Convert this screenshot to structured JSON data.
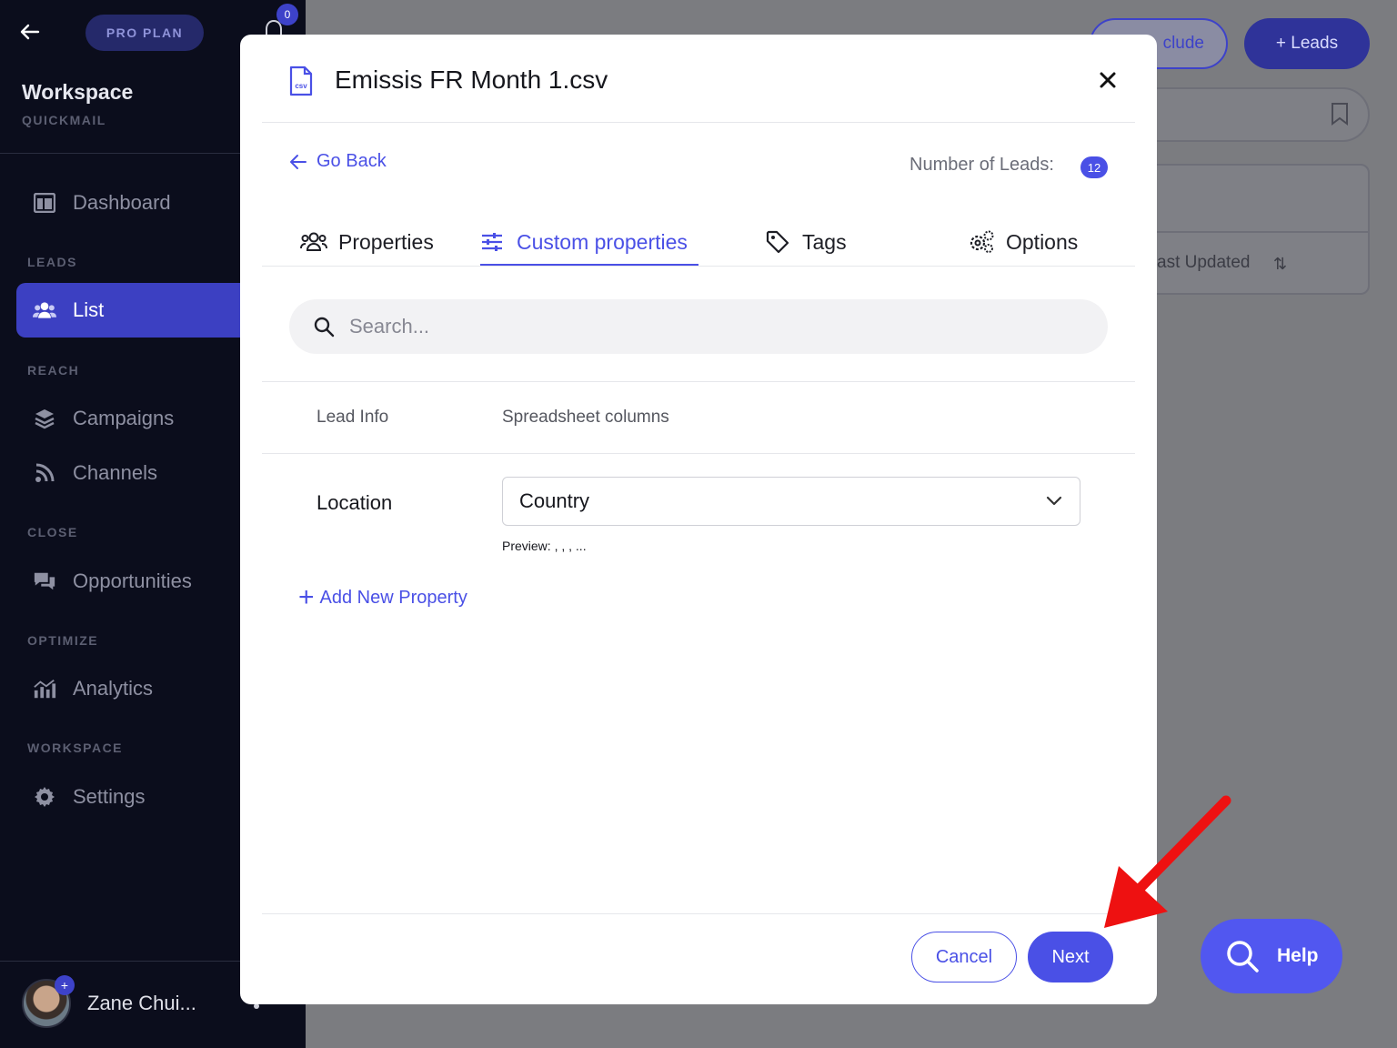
{
  "sidebar": {
    "plan": "PRO PLAN",
    "notifications": "0",
    "workspace_title": "Workspace",
    "workspace_sub": "QUICKMAIL",
    "items": [
      {
        "section": "",
        "label": "Dashboard",
        "icon": "dashboard-icon",
        "active": false
      },
      {
        "section": "LEADS",
        "label": "List",
        "icon": "users-icon",
        "active": true
      },
      {
        "section": "REACH",
        "label": "Campaigns",
        "icon": "layers-icon",
        "active": false
      },
      {
        "section": "",
        "label": "Channels",
        "icon": "rss-icon",
        "active": false
      },
      {
        "section": "CLOSE",
        "label": "Opportunities",
        "icon": "chat-icon",
        "active": false
      },
      {
        "section": "OPTIMIZE",
        "label": "Analytics",
        "icon": "analytics-icon",
        "active": false
      },
      {
        "section": "WORKSPACE",
        "label": "Settings",
        "icon": "gear-icon",
        "active": false
      }
    ],
    "sections": {
      "leads": "LEADS",
      "reach": "REACH",
      "close": "CLOSE",
      "optimize": "OPTIMIZE",
      "workspace": "WORKSPACE"
    },
    "user_name": "Zane Chui...",
    "avatar_plus": "+"
  },
  "background": {
    "exclude_label": "clude",
    "leads_button": "+ Leads",
    "last_updated": "ast Updated",
    "sort_glyph": "⇅"
  },
  "modal": {
    "file_name": "Emissis FR Month 1.csv",
    "go_back": "Go Back",
    "num_leads_label": "Number of Leads:",
    "num_leads_value": "12",
    "tabs": [
      {
        "label": "Properties",
        "icon": "people-icon",
        "active": false
      },
      {
        "label": "Custom properties",
        "icon": "sliders-icon",
        "active": true
      },
      {
        "label": "Tags",
        "icon": "tag-icon",
        "active": false
      },
      {
        "label": "Options",
        "icon": "cogs-icon",
        "active": false
      }
    ],
    "search_placeholder": "Search...",
    "columns": {
      "lead_info": "Lead Info",
      "spreadsheet": "Spreadsheet columns"
    },
    "rows": [
      {
        "label": "Location",
        "selected": "Country",
        "preview": "Preview: , , , ..."
      }
    ],
    "add_property": "Add New Property",
    "cancel": "Cancel",
    "next": "Next"
  },
  "help": {
    "label": "Help"
  },
  "colors": {
    "accent": "#4a50e6",
    "sidebar_bg": "#0b0d1c",
    "annotation_arrow": "#ee1111"
  }
}
